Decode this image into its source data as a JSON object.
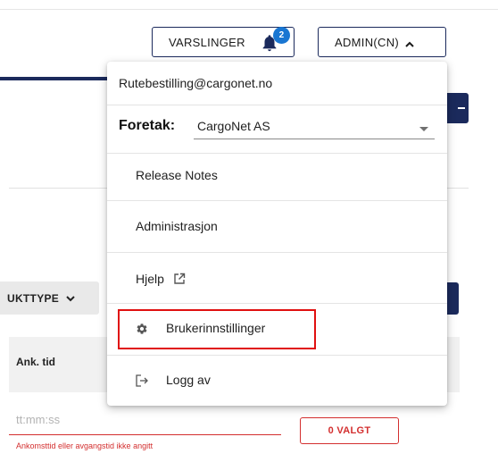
{
  "header": {
    "notifications_label": "VARSLINGER",
    "notifications_count": "2",
    "admin_label": "ADMIN(CN)"
  },
  "background": {
    "product_type_label": "UKTTYPE",
    "table_header_arrival": "Ank. tid",
    "time_placeholder": "tt:mm:ss",
    "error_text": "Ankomsttid eller avgangstid ikke angitt",
    "selected_button_label": "0 VALGT"
  },
  "menu": {
    "email": "Rutebestilling@cargonet.no",
    "company_label": "Foretak:",
    "company_value": "CargoNet AS",
    "items": [
      {
        "label": "Release Notes"
      },
      {
        "label": "Administrasjon"
      },
      {
        "label": "Hjelp",
        "icon": "external-link-icon"
      },
      {
        "label": "Brukerinnstillinger",
        "icon": "gear-icon"
      },
      {
        "label": "Logg av",
        "icon": "logout-icon"
      }
    ]
  },
  "colors": {
    "navy": "#1b2a5c",
    "badge_blue": "#1976d2",
    "error_red": "#d32f2f",
    "highlight_red": "#e01010"
  }
}
